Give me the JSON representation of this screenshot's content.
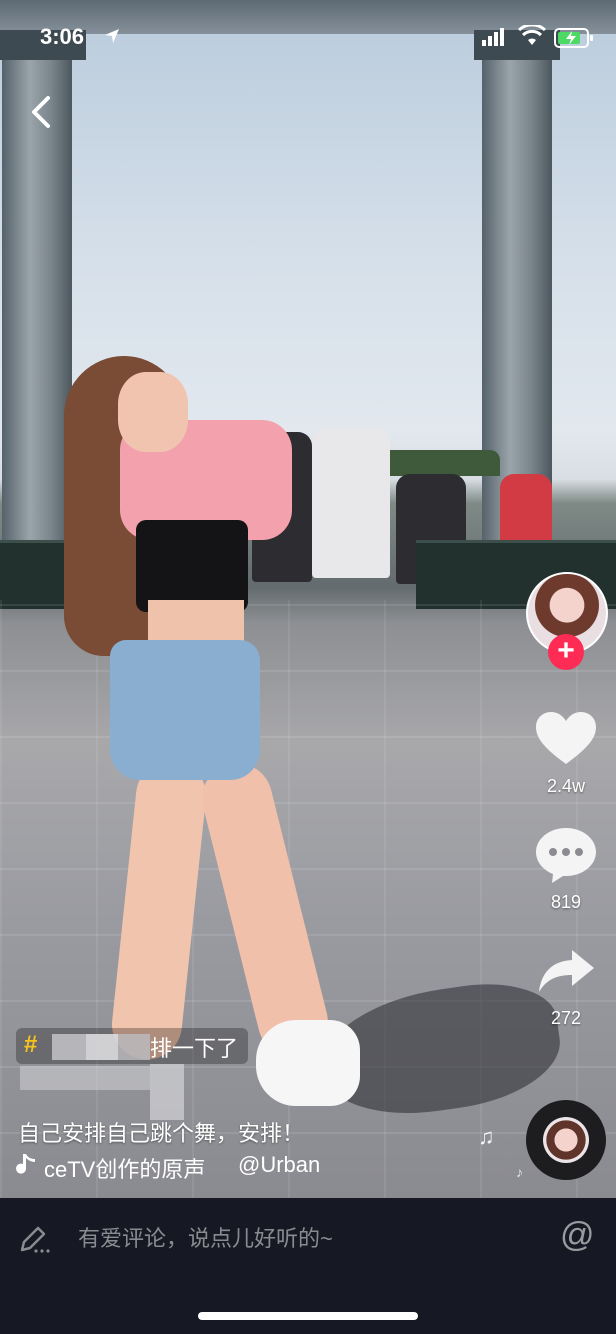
{
  "status_bar": {
    "time": "3:06"
  },
  "video": {
    "hashtag_text": "排一下了",
    "description": "自己安排自己跳个舞，安排！",
    "music": {
      "sound_prefix": "ceTV创作的原声",
      "sound_author": "@Urban"
    },
    "blurred_author_handle": "@ ..."
  },
  "actions": {
    "likes": "2.4w",
    "comments": "819",
    "shares": "272"
  },
  "comment_bar": {
    "placeholder": "有爱评论，说点儿好听的~",
    "mention_symbol": "@"
  },
  "colors": {
    "accent_red": "#fe2c55",
    "hashtag_yellow": "#f6c21b",
    "bar_bg": "#161823"
  },
  "icons": [
    "location-arrow-icon",
    "signal-icon",
    "wifi-icon",
    "battery-icon",
    "back-icon",
    "plus-icon",
    "heart-icon",
    "comment-icon",
    "share-icon",
    "music-note-icon",
    "pen-icon",
    "at-icon"
  ]
}
